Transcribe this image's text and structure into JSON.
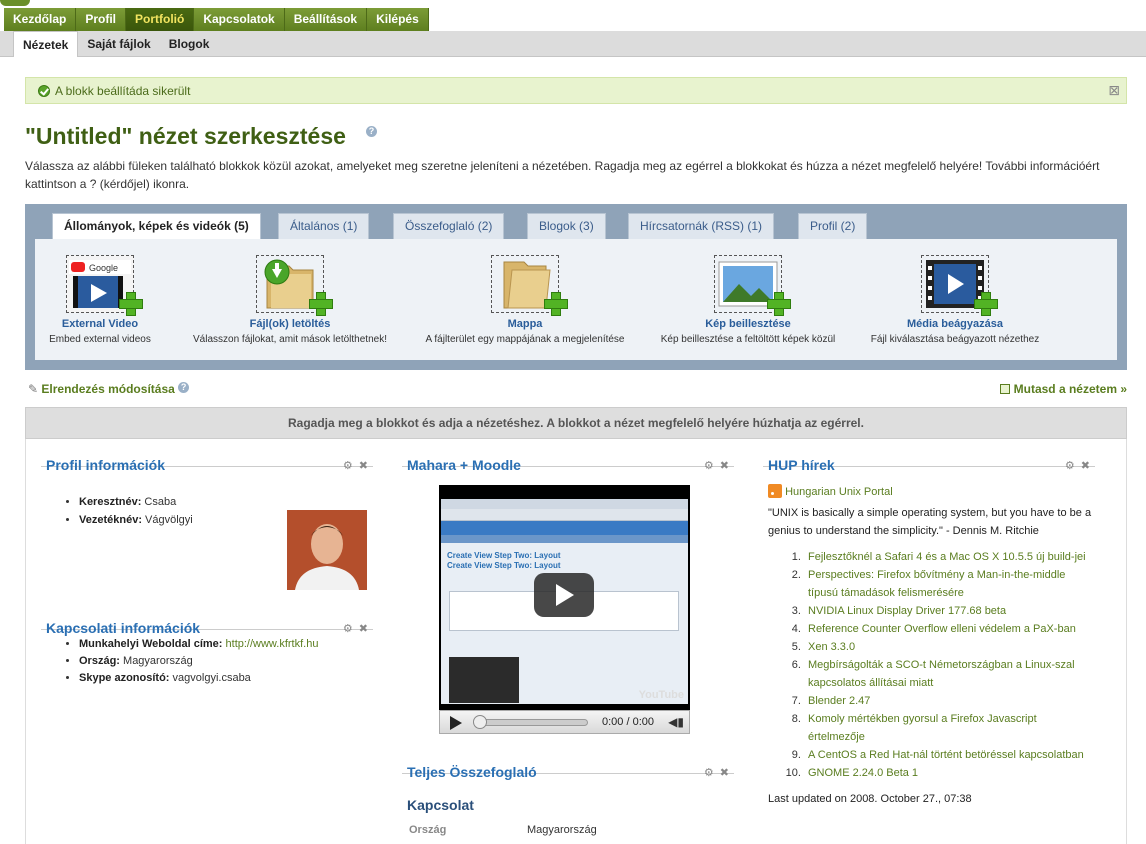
{
  "nav": {
    "main": [
      "Kezdőlap",
      "Profil",
      "Portfolió",
      "Kapcsolatok",
      "Beállítások",
      "Kilépés"
    ],
    "main_active": 2,
    "sub": [
      "Nézetek",
      "Saját fájlok",
      "Blogok"
    ],
    "sub_active": 0
  },
  "message": {
    "text": "A blokk beállítáda sikerült"
  },
  "page": {
    "title": "\"Untitled\" nézet szerkesztése",
    "intro": "Válassza az alábbi füleken található blokkok közül azokat, amelyeket meg szeretne jeleníteni a nézetében. Ragadja meg az egérrel a blokkokat és húzza a nézet megfelelő helyére! További információért kattintson a ? (kérdőjel) ikonra.",
    "help_glyph": "?"
  },
  "tabs": [
    "Állományok, képek és videók (5)",
    "Általános (1)",
    "Összefoglaló (2)",
    "Blogok (3)",
    "Hírcsatornák (RSS) (1)",
    "Profil (2)"
  ],
  "blocks": [
    {
      "name": "External Video",
      "desc": "Embed external videos",
      "icon": "youtube-video-icon"
    },
    {
      "name": "Fájl(ok) letöltés",
      "desc": "Válasszon fájlokat, amit mások letölthetnek!",
      "icon": "download-folder-icon"
    },
    {
      "name": "Mappa",
      "desc": "A fájlterület egy mappájának a megjelenítése",
      "icon": "folder-icon"
    },
    {
      "name": "Kép beillesztése",
      "desc": "Kép beillesztése a feltöltött képek közül",
      "icon": "image-icon"
    },
    {
      "name": "Média beágyazása",
      "desc": "Fájl kiválasztása beágyazott nézethez",
      "icon": "film-icon"
    }
  ],
  "links": {
    "layout": "Elrendezés módosítása",
    "show": "Mutasd a nézetem »"
  },
  "dropbar": "Ragadja meg a blokkot és adja a nézetéshez. A blokkot a nézet megfelelő helyére húzhatja az egérrel.",
  "profile": {
    "title": "Profil információk",
    "items": [
      {
        "label": "Keresztnév:",
        "value": "Csaba"
      },
      {
        "label": "Vezetéknév:",
        "value": "Vágvölgyi"
      }
    ]
  },
  "contact": {
    "title": "Kapcsolati információk",
    "items": [
      {
        "label": "Munkahelyi Weboldal címe:",
        "value": "http://www.kfrtkf.hu"
      },
      {
        "label": "Ország:",
        "value": "Magyarország"
      },
      {
        "label": "Skype azonosító:",
        "value": "vagvolgyi.csaba"
      }
    ]
  },
  "video": {
    "title": "Mahara + Moodle",
    "time": "0:00 / 0:00",
    "overlay": [
      "Create View Step Two: Layout",
      "Create View Step Two: Layout"
    ],
    "brand": "YouTube"
  },
  "summary": {
    "title": "Teljes Összefoglaló",
    "subtitle": "Kapcsolat",
    "row_label": "Ország",
    "row_value": "Magyarország"
  },
  "hup": {
    "title": "HUP hírek",
    "feed": "Hungarian Unix Portal",
    "quote": "\"UNIX is basically a simple operating system, but you have to be a genius to understand the simplicity.\" - Dennis M. Ritchie",
    "news": [
      "Fejlesztőknél a Safari 4 és a Mac OS X 10.5.5 új build-jei",
      "Perspectives: Firefox bővítmény a Man-in-the-middle típusú támadások felismerésére",
      "NVIDIA Linux Display Driver 177.68 beta",
      "Reference Counter Overflow elleni védelem a PaX-ban",
      "Xen 3.3.0",
      "Megbírságolták a SCO-t Németországban a Linux-szal kapcsolatos állításai miatt",
      "Blender 2.47",
      "Komoly mértékben gyorsul a Firefox Javascript értelmezője",
      "A CentOS a Red Hat-nál történt betöréssel kapcsolatban",
      "GNOME 2.24.0 Beta 1"
    ],
    "updated": "Last updated on 2008. October 27., 07:38"
  },
  "icons": {
    "close": "close-icon",
    "settings": "gear-icon"
  },
  "colors": {
    "nav_green": "#6b8f2a",
    "nav_active_text": "#f2e460",
    "title_green": "#3f5f14",
    "block_title_blue": "#2a6fb3",
    "panel_bg": "#8fa3b8",
    "success_bg": "#e8f3cf"
  }
}
